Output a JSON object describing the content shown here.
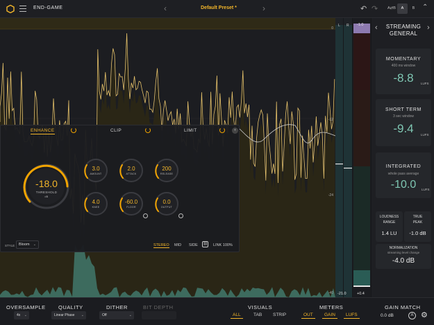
{
  "top": {
    "title": "END-GAME",
    "preset": "Default Preset *",
    "ab_toggle": "A⇄B",
    "a": "A",
    "b": "B"
  },
  "analyzer": {
    "db_labels": [
      "0",
      "-12",
      "-24",
      "-40"
    ]
  },
  "panel": {
    "tabs": [
      "ENHANCE",
      "CLIP",
      "LIMIT"
    ],
    "threshold": {
      "value": "-18.0",
      "label": "THRESHOLD",
      "unit": "dB"
    },
    "knobs": [
      {
        "value": "3.0",
        "label": "AMOUNT"
      },
      {
        "value": "2.0",
        "label": "ATTACK"
      },
      {
        "value": "200",
        "label": "RELEASE"
      },
      {
        "value": "4.0",
        "label": "KNEE"
      },
      {
        "value": "-60.0",
        "label": "FLOOR"
      },
      {
        "value": "0.0",
        "label": "OUTPUT"
      }
    ],
    "style_label": "STYLE",
    "style_value": "Bloom",
    "modes": [
      "STEREO",
      "MID",
      "SIDE"
    ],
    "link": "LINK 100%"
  },
  "meters": {
    "l_label": "L",
    "r_label": "R",
    "peak_top": "-1.0",
    "peak_bottom_l": "-21.0",
    "peak_bottom_r": "+0.4"
  },
  "sidebar": {
    "target": "STREAMING",
    "target_sub": "GENERAL",
    "momentary": {
      "title": "MOMENTARY",
      "sub": "400 ms window",
      "value": "-8.8",
      "unit": "LUFS"
    },
    "short_term": {
      "title": "SHORT TERM",
      "sub": "3 sec window",
      "value": "-9.4",
      "unit": "LUFS"
    },
    "integrated": {
      "title": "INTEGRATED",
      "sub": "whole pass average",
      "value": "-10.0",
      "unit": "LUFS"
    },
    "loudness_range": {
      "title1": "LOUDNESS",
      "title2": "RANGE",
      "value": "1.4 LU"
    },
    "true_peak": {
      "title1": "TRUE",
      "title2": "PEAK",
      "value": "-1.0 dB"
    },
    "normalization": {
      "title": "NORMALIZATION",
      "sub": "streaming level change",
      "value": "-4.0 dB"
    }
  },
  "bottom": {
    "oversample": {
      "title": "OVERSAMPLE",
      "value": "4x"
    },
    "quality": {
      "title": "QUALITY",
      "value": "Linear Phase"
    },
    "dither": {
      "title": "DITHER",
      "value": "Off"
    },
    "bit_depth": {
      "title": "BIT DEPTH"
    },
    "visuals": {
      "title": "VISUALS",
      "options": [
        "ALL",
        "TAB",
        "STRIP"
      ]
    },
    "meters": {
      "title": "METERS",
      "options": [
        "OUT",
        "GAIN",
        "LUFS"
      ]
    },
    "gain_match": {
      "title": "GAIN MATCH",
      "value": "0.0 dB"
    }
  },
  "colors": {
    "accent": "#f2b52a",
    "lufs": "#7fc7b3",
    "bg": "#17181b"
  }
}
